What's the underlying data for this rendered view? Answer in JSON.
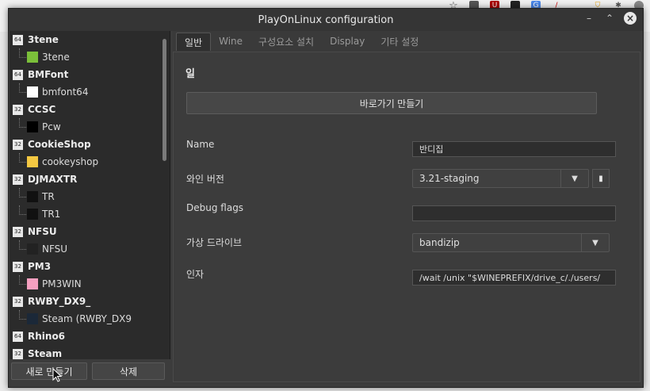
{
  "window": {
    "title": "PlayOnLinux configuration"
  },
  "tree": {
    "items": [
      {
        "type": "parent",
        "version": "64",
        "label": "3tene"
      },
      {
        "type": "child",
        "label": "3tene",
        "icon": "android-icon",
        "color": "#7bbf3a"
      },
      {
        "type": "parent",
        "version": "64",
        "label": "BMFont"
      },
      {
        "type": "child",
        "label": "bmfont64",
        "icon": "bmfont-icon",
        "color": "#ffffff"
      },
      {
        "type": "parent",
        "version": "32",
        "label": "CCSC"
      },
      {
        "type": "child",
        "label": "Pcw",
        "icon": "terminal-icon",
        "color": "#000000"
      },
      {
        "type": "parent",
        "version": "32",
        "label": "CookieShop"
      },
      {
        "type": "child",
        "label": "cookeyshop",
        "icon": "cookie-icon",
        "color": "#f4c842"
      },
      {
        "type": "parent",
        "version": "32",
        "label": "DJMAXTR"
      },
      {
        "type": "child",
        "label": "TR",
        "icon": "djmax-icon",
        "color": "#111111"
      },
      {
        "type": "child",
        "label": "TR1",
        "icon": "djmax-icon",
        "color": "#111111"
      },
      {
        "type": "parent",
        "version": "32",
        "label": "NFSU"
      },
      {
        "type": "child",
        "label": "NFSU",
        "icon": "nfsu-icon",
        "color": "#222222"
      },
      {
        "type": "parent",
        "version": "32",
        "label": "PM3"
      },
      {
        "type": "child",
        "label": "PM3WIN",
        "icon": "pm3-icon",
        "color": "#f5a0c0"
      },
      {
        "type": "parent",
        "version": "32",
        "label": "RWBY_DX9_"
      },
      {
        "type": "child",
        "label": "Steam (RWBY_DX9",
        "icon": "steam-icon",
        "color": "#1b2838"
      },
      {
        "type": "parent",
        "version": "64",
        "label": "Rhino6"
      },
      {
        "type": "parent",
        "version": "32",
        "label": "Steam"
      }
    ]
  },
  "buttons": {
    "new": "새로 만들기",
    "delete": "삭제"
  },
  "tabs": [
    "일반",
    "Wine",
    "구성요소 설치",
    "Display",
    "기타 설정"
  ],
  "general": {
    "section_title": "일",
    "shortcut_button": "바로가기 만들기",
    "name_label": "Name",
    "name_value": "반디집",
    "wine_label": "와인 버전",
    "wine_value": "3.21-staging",
    "debug_label": "Debug flags",
    "debug_value": "",
    "drive_label": "가상 드라이브",
    "drive_value": "bandizip",
    "args_label": "인자",
    "args_value": "/wait /unix \"$WINEPREFIX/drive_c/./users/"
  },
  "colors": {
    "window_bg": "#3c3c3c",
    "tree_bg": "#2b2b2b",
    "titlebar": "#353535"
  }
}
